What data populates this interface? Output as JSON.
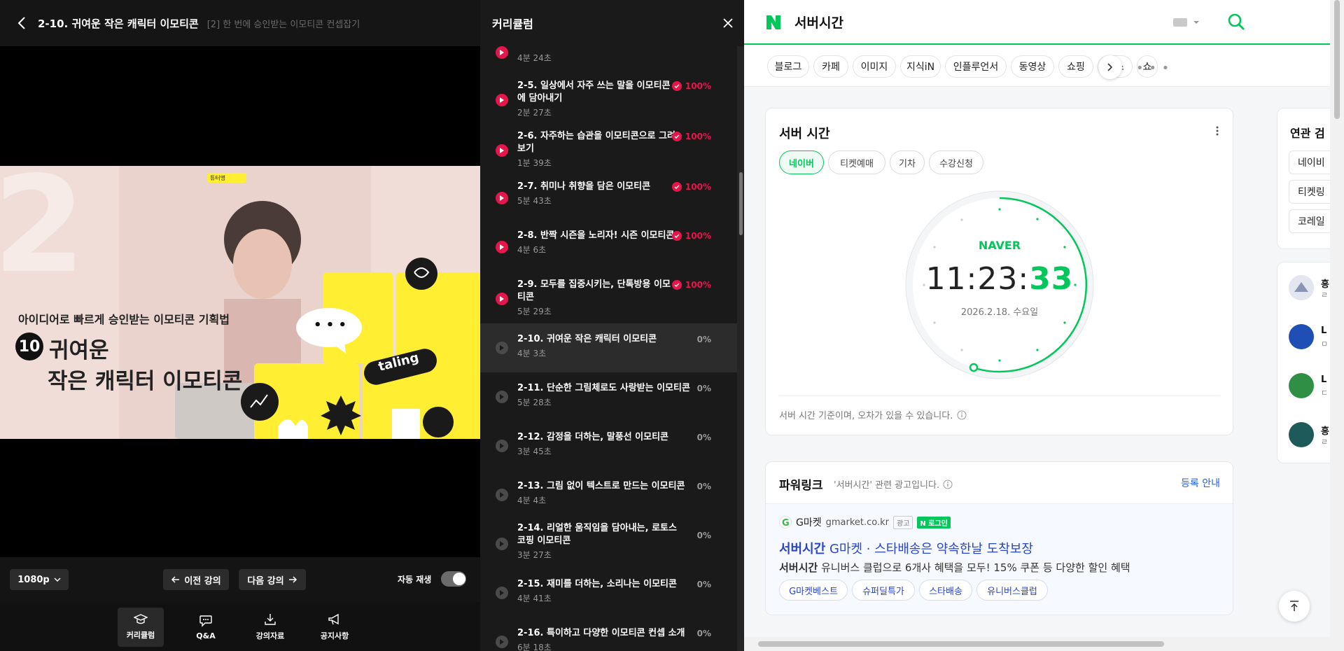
{
  "player": {
    "title": "2-10. 귀여운 작은 캐릭터 이모티콘",
    "subtitle": "[2] 한 번에 승인받는 이모티콘 컨셉잡기",
    "video": {
      "kicker": "아이디어로 빠르게 승인받는 이모티콘 기획법",
      "number": "10",
      "line1": "귀여운",
      "line2": "작은 캐릭터 이모티콘",
      "brand": "taling",
      "badge": "튜터명",
      "bubble": "• • •"
    },
    "controls": {
      "quality": "1080p",
      "prev": "이전 강의",
      "next": "다음 강의",
      "autoplay_label": "자동 재생",
      "autoplay_on": false
    },
    "nav": [
      {
        "label": "커리큘럼",
        "icon": "graduation-cap-icon",
        "active": true
      },
      {
        "label": "Q&A",
        "icon": "chat-bubble-icon",
        "active": false
      },
      {
        "label": "강의자료",
        "icon": "download-icon",
        "active": false
      },
      {
        "label": "공지사항",
        "icon": "megaphone-icon",
        "active": false
      }
    ]
  },
  "curriculum": {
    "title": "커리큘럼",
    "items": [
      {
        "title": "",
        "duration": "4분 24초",
        "progress": "",
        "done": true
      },
      {
        "title": "2-5. 일상에서 자주 쓰는 말을 이모티콘에 담아내기",
        "duration": "2분 27초",
        "progress": "100%",
        "done": true
      },
      {
        "title": "2-6. 자주하는 습관을 이모티콘으로 그려보기",
        "duration": "1분 39초",
        "progress": "100%",
        "done": true
      },
      {
        "title": "2-7. 취미나 취향을 담은 이모티콘",
        "duration": "5분 43초",
        "progress": "100%",
        "done": true
      },
      {
        "title": "2-8. 반짝 시즌을 노리자! 시즌 이모티콘",
        "duration": "4분 6초",
        "progress": "100%",
        "done": true
      },
      {
        "title": "2-9. 모두를 집중시키는, 단톡방용 이모티콘",
        "duration": "5분 29초",
        "progress": "100%",
        "done": true
      },
      {
        "title": "2-10. 귀여운 작은 캐릭터 이모티콘",
        "duration": "4분 3초",
        "progress": "0%",
        "done": false,
        "active": true
      },
      {
        "title": "2-11. 단순한 그림체로도 사랑받는 이모티콘",
        "duration": "5분 28초",
        "progress": "0%",
        "done": false
      },
      {
        "title": "2-12. 감정을 더하는, 말풍선 이모티콘",
        "duration": "3분 45초",
        "progress": "0%",
        "done": false
      },
      {
        "title": "2-13. 그림 없이 텍스트로 만드는 이모티콘",
        "duration": "4분 4초",
        "progress": "0%",
        "done": false
      },
      {
        "title": "2-14. 리얼한 움직임을 담아내는, 로토스코핑 이모티콘",
        "duration": "3분 27초",
        "progress": "0%",
        "done": false
      },
      {
        "title": "2-15. 재미를 더하는, 소리나는 이모티콘",
        "duration": "4분 41초",
        "progress": "0%",
        "done": false
      },
      {
        "title": "2-16. 특이하고 다양한 이모티콘 컨셉 소개",
        "duration": "6분 18초",
        "progress": "0%",
        "done": false
      }
    ]
  },
  "naver": {
    "query": "서버시간",
    "tabs": [
      "블로그",
      "카페",
      "이미지",
      "지식iN",
      "인플루언서",
      "동영상",
      "쇼핑",
      "뉴스",
      "쇼"
    ],
    "server_time": {
      "title": "서버 시간",
      "chips": [
        "네이버",
        "티켓예매",
        "기차",
        "수강신청"
      ],
      "brand": "NAVER",
      "time_hm": "11:23:",
      "time_s": "33",
      "date": "2026.2.18. 수요일",
      "note": "서버 시간 기준이며, 오차가 있을 수 있습니다."
    },
    "powerlink": {
      "title": "파워링크",
      "desc": "'서버시간' 관련 광고입니다.",
      "register": "등록 안내",
      "brand": "G마켓",
      "domain": "gmarket.co.kr",
      "tag_ad": "광고",
      "tag_login": "N 로그인",
      "headline_bold": "서버시간",
      "headline_rest": " G마켓 · 스타배송은 약속한날 도착보장",
      "text_bold": "서버시간",
      "text_rest": " 유니버스 클럽으로 6개사 혜택을 모두! 15% 쿠폰 등 다양한 할인 혜택",
      "chips": [
        "G마켓베스트",
        "슈퍼딜특가",
        "스타배송",
        "유니버스클럽"
      ]
    },
    "related": {
      "title": "연관 검",
      "items": [
        "네이비",
        "티켓링",
        "코레일"
      ]
    },
    "people": [
      {
        "name": "흥",
        "sub": "ㄹ"
      },
      {
        "name": "L",
        "sub": "ㅁ"
      },
      {
        "name": "L",
        "sub": "ㄷ"
      },
      {
        "name": "흥",
        "sub": "ㄹ"
      }
    ]
  }
}
